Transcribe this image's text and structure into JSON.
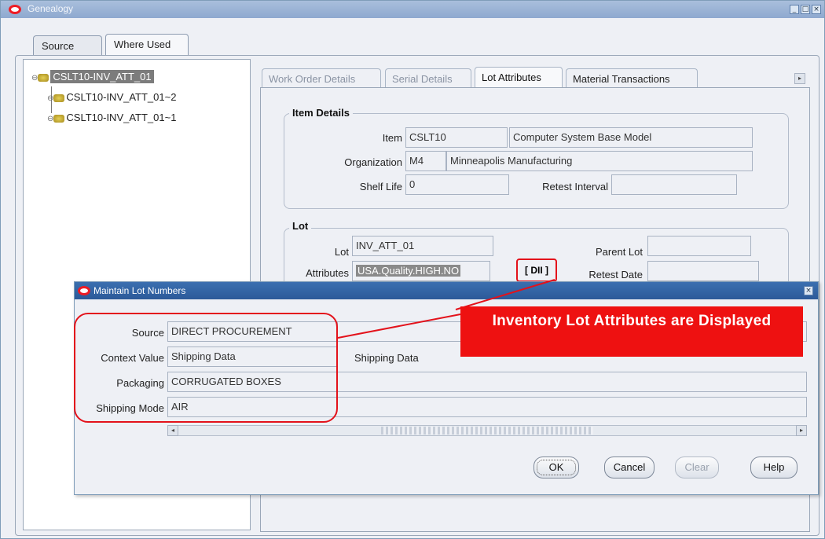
{
  "window": {
    "title": "Genealogy"
  },
  "main_tabs": [
    {
      "label": "Source"
    },
    {
      "label": "Where Used"
    }
  ],
  "tree": {
    "root": "CSLT10-INV_ATT_01",
    "children": [
      "CSLT10-INV_ATT_01~2",
      "CSLT10-INV_ATT_01~1"
    ]
  },
  "detail_tabs": [
    {
      "label": "Work Order Details"
    },
    {
      "label": "Serial Details"
    },
    {
      "label": "Lot Attributes"
    },
    {
      "label": "Material Transactions"
    }
  ],
  "item_details": {
    "title": "Item Details",
    "item_label": "Item",
    "item_value": "CSLT10",
    "item_desc": "Computer System Base Model",
    "org_label": "Organization",
    "org_value": "M4",
    "org_desc": "Minneapolis Manufacturing",
    "shelf_label": "Shelf Life",
    "shelf_value": "0",
    "retest_interval_label": "Retest Interval",
    "retest_interval_value": ""
  },
  "lot": {
    "title": "Lot",
    "lot_label": "Lot",
    "lot_value": "INV_ATT_01",
    "parent_label": "Parent Lot",
    "parent_value": "",
    "attributes_label": "Attributes",
    "attributes_value": "USA.Quality.HIGH.NO",
    "dff_button": "[ DII ]",
    "retest_date_label": "Retest Date",
    "retest_date_value": ""
  },
  "dialog": {
    "title": "Maintain Lot Numbers",
    "source_label": "Source",
    "source_value": "DIRECT PROCUREMENT",
    "context_label": "Context Value",
    "context_value": "Shipping Data",
    "context_desc": "Shipping Data",
    "packaging_label": "Packaging",
    "packaging_value": "CORRUGATED BOXES",
    "shipping_mode_label": "Shipping Mode",
    "shipping_mode_value": "AIR",
    "buttons": {
      "ok": "OK",
      "cancel": "Cancel",
      "clear": "Clear",
      "help": "Help"
    }
  },
  "callout": {
    "text": "Inventory Lot Attributes are Displayed"
  },
  "colors": {
    "accent_red": "#ee1111",
    "titlebar_blue": "#2c5a99"
  }
}
